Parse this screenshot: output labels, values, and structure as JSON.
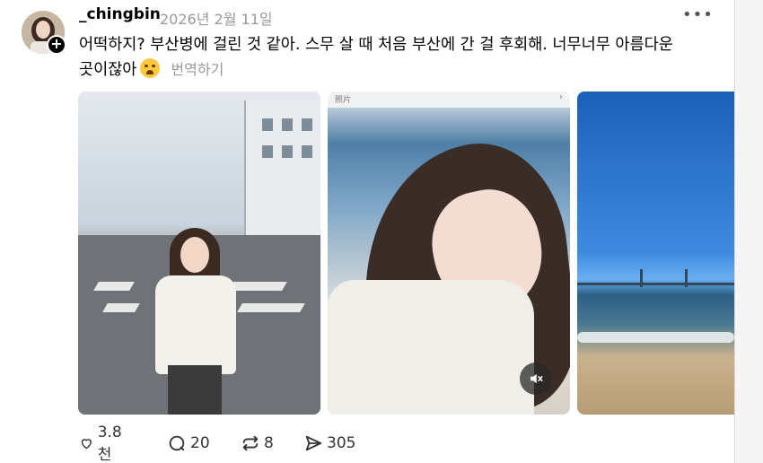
{
  "post": {
    "username": "_chingbin",
    "date": "2026년 2월 11일",
    "more_label": "•••",
    "text_line1": "어떡하지? 부산병에 걸린 것 같아. 스무 살 때 처음 부산에 간 걸 후회해. 너무너무 아름다운",
    "text_line2": "곳이잖아",
    "translate_label": "번역하기",
    "avatar_plus": "+"
  },
  "media": {
    "image2_topbar": "照片",
    "mute_icon": "mute-icon"
  },
  "actions": {
    "likes": "3.8천",
    "replies": "20",
    "reposts": "8",
    "shares": "305"
  },
  "colors": {
    "date_gray": "#999999",
    "text": "#000000",
    "icon": "#333333"
  }
}
